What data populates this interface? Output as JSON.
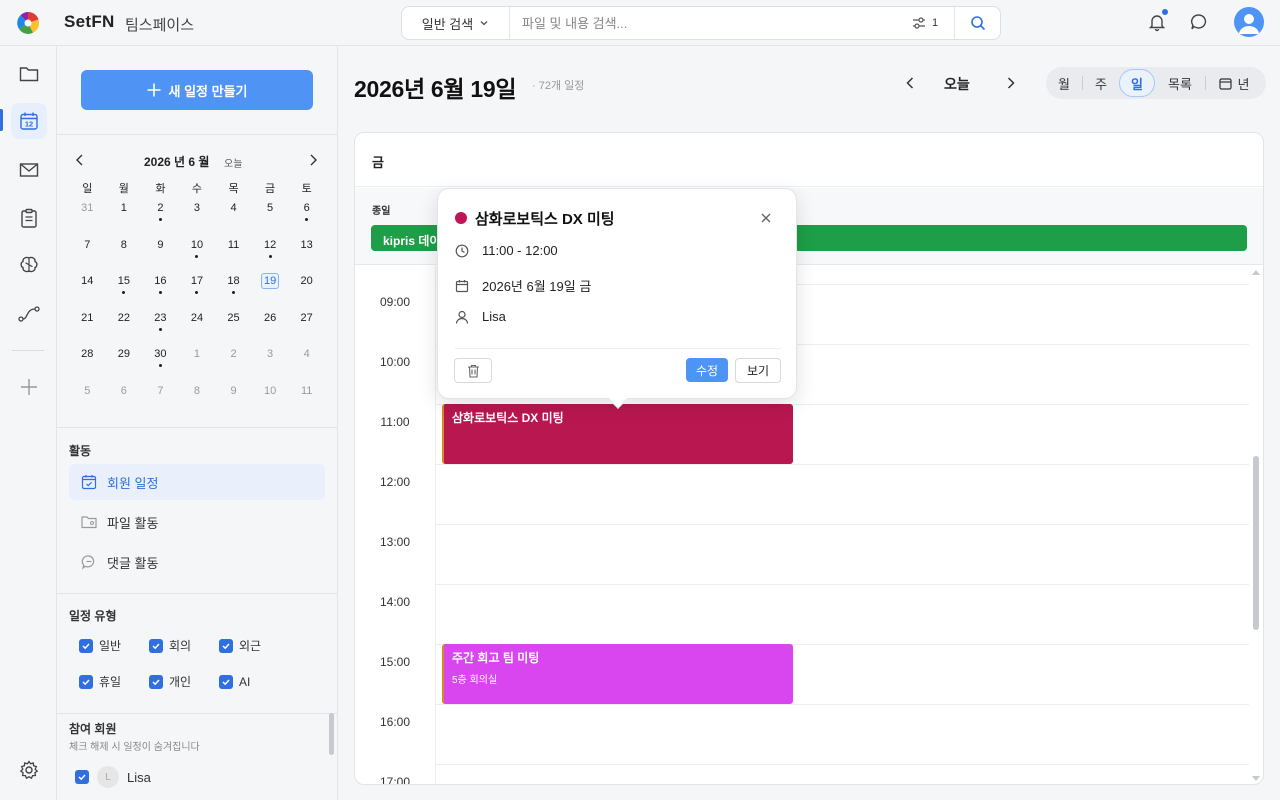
{
  "app": {
    "brand": "SetFN",
    "workspace": "팀스페이스"
  },
  "search": {
    "type_label": "일반 검색",
    "placeholder": "파일 및 내용 검색...",
    "filter_count": "1"
  },
  "colors": {
    "accent": "#4f93f5",
    "primary": "#2f6fe0",
    "allday_event": "#1e9e48",
    "event_dx": "#b8174f",
    "event_review": "#d946ef"
  },
  "sidebar": {
    "create_label": "새 일정 만들기",
    "mini_calendar": {
      "title": "2026 년 6 월",
      "today_label": "오늘",
      "weekdays": [
        "일",
        "월",
        "화",
        "수",
        "목",
        "금",
        "토"
      ],
      "weeks": [
        [
          {
            "d": "31",
            "m": true
          },
          {
            "d": "1"
          },
          {
            "d": "2",
            "dot": true
          },
          {
            "d": "3"
          },
          {
            "d": "4"
          },
          {
            "d": "5"
          },
          {
            "d": "6",
            "dot": true
          }
        ],
        [
          {
            "d": "7"
          },
          {
            "d": "8"
          },
          {
            "d": "9"
          },
          {
            "d": "10",
            "dot": true
          },
          {
            "d": "11"
          },
          {
            "d": "12",
            "dot": true
          },
          {
            "d": "13"
          }
        ],
        [
          {
            "d": "14"
          },
          {
            "d": "15",
            "dot": true
          },
          {
            "d": "16",
            "dot": true
          },
          {
            "d": "17",
            "dot": true
          },
          {
            "d": "18",
            "dot": true
          },
          {
            "d": "19",
            "sel": true
          },
          {
            "d": "20"
          }
        ],
        [
          {
            "d": "21"
          },
          {
            "d": "22"
          },
          {
            "d": "23",
            "dot": true
          },
          {
            "d": "24"
          },
          {
            "d": "25"
          },
          {
            "d": "26"
          },
          {
            "d": "27"
          }
        ],
        [
          {
            "d": "28"
          },
          {
            "d": "29"
          },
          {
            "d": "30",
            "dot": true
          },
          {
            "d": "1",
            "m": true
          },
          {
            "d": "2",
            "m": true
          },
          {
            "d": "3",
            "m": true
          },
          {
            "d": "4",
            "m": true
          }
        ],
        [
          {
            "d": "5",
            "m": true
          },
          {
            "d": "6",
            "m": true
          },
          {
            "d": "7",
            "m": true
          },
          {
            "d": "8",
            "m": true
          },
          {
            "d": "9",
            "m": true
          },
          {
            "d": "10",
            "m": true
          },
          {
            "d": "11",
            "m": true
          }
        ]
      ]
    },
    "activity": {
      "title": "활동",
      "items": [
        "회원 일정",
        "파일 활동",
        "댓글 활동"
      ]
    },
    "types": {
      "title": "일정 유형",
      "row1": [
        "일반",
        "회의",
        "외근"
      ],
      "row2": [
        "휴일",
        "개인",
        "AI"
      ]
    },
    "members": {
      "title": "참여 회원",
      "subtitle": "체크 해제 시 일정이 숨겨집니다",
      "list": [
        {
          "initial": "L",
          "name": "Lisa"
        }
      ]
    }
  },
  "main": {
    "title": "2026년 6월 19일",
    "count": "72개 일정",
    "today_label": "오늘",
    "views": [
      "월",
      "주",
      "일",
      "목록",
      "년"
    ],
    "active_view": "일",
    "day_label": "금",
    "allday_label": "종일",
    "allday_event": "kipris 데이",
    "hours": [
      "09:00",
      "10:00",
      "11:00",
      "12:00",
      "13:00",
      "14:00",
      "15:00",
      "16:00",
      "17:00"
    ],
    "events": [
      {
        "title": "삼화로보틱스 DX 미팅",
        "sub": "",
        "start": "11:00",
        "end": "12:00"
      },
      {
        "title": "주간 회고 팀 미팅",
        "sub": "5층 회의실",
        "start": "15:00",
        "end": "16:00"
      }
    ]
  },
  "popup": {
    "title": "삼화로보틱스 DX 미팅",
    "time": "11:00 - 12:00",
    "date": "2026년 6월 19일 금",
    "owner": "Lisa",
    "edit_label": "수정",
    "view_label": "보기"
  }
}
